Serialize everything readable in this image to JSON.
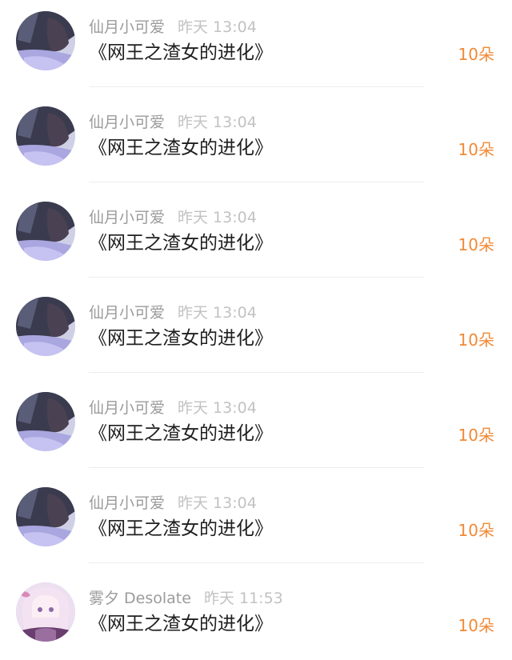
{
  "rows": [
    {
      "user": "仙月小可爱",
      "time": "昨天 13:04",
      "title": "《网王之渣女的进化》",
      "amount": "10朵",
      "avatar_icon": "anime-girl-dark-avatar"
    },
    {
      "user": "仙月小可爱",
      "time": "昨天 13:04",
      "title": "《网王之渣女的进化》",
      "amount": "10朵",
      "avatar_icon": "anime-girl-dark-avatar"
    },
    {
      "user": "仙月小可爱",
      "time": "昨天 13:04",
      "title": "《网王之渣女的进化》",
      "amount": "10朵",
      "avatar_icon": "anime-girl-dark-avatar"
    },
    {
      "user": "仙月小可爱",
      "time": "昨天 13:04",
      "title": "《网王之渣女的进化》",
      "amount": "10朵",
      "avatar_icon": "anime-girl-dark-avatar"
    },
    {
      "user": "仙月小可爱",
      "time": "昨天 13:04",
      "title": "《网王之渣女的进化》",
      "amount": "10朵",
      "avatar_icon": "anime-girl-dark-avatar"
    },
    {
      "user": "仙月小可爱",
      "time": "昨天 13:04",
      "title": "《网王之渣女的进化》",
      "amount": "10朵",
      "avatar_icon": "anime-girl-dark-avatar"
    },
    {
      "user": "雾夕 Desolate",
      "time": "昨天 11:53",
      "title": "《网王之渣女的进化》",
      "amount": "10朵",
      "avatar_icon": "anime-girl-pink-avatar"
    }
  ],
  "colors": {
    "amount": "#f08a36",
    "username": "#9b9b9b",
    "time": "#c2c2c2",
    "title": "#1f1f1f",
    "divider": "#ededed"
  }
}
